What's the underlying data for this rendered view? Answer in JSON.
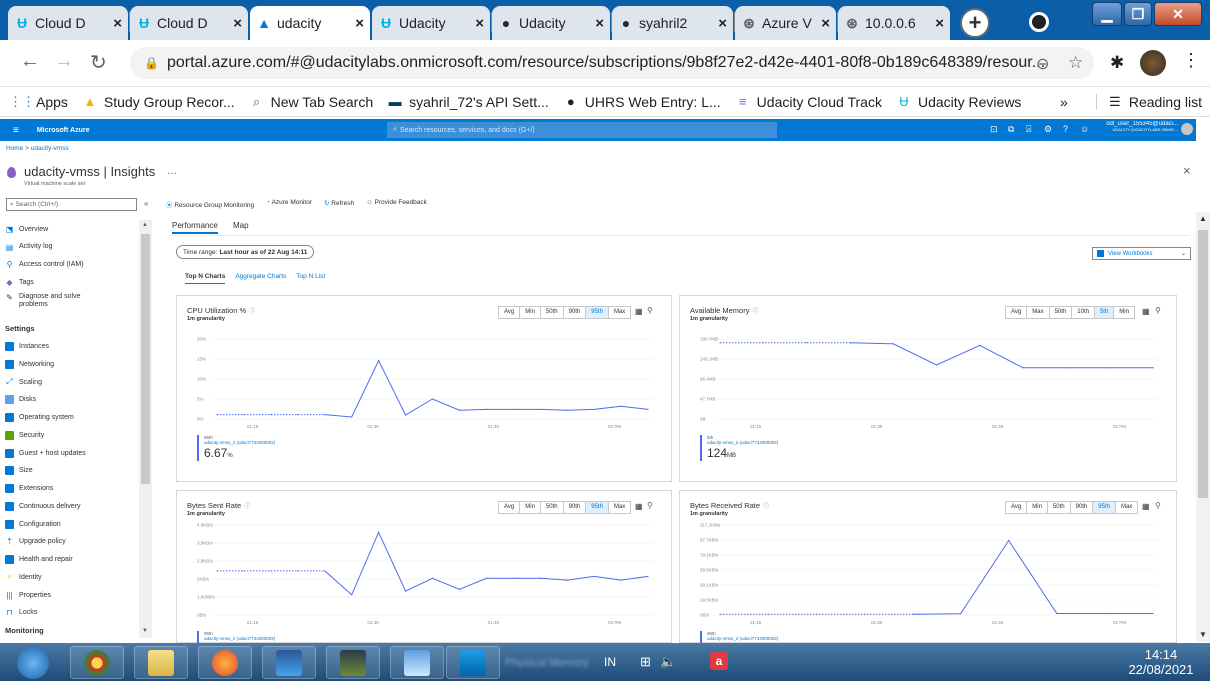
{
  "browser": {
    "tabs": [
      {
        "title": "Cloud D",
        "icon": "udacity-icon",
        "active": false
      },
      {
        "title": "Cloud D",
        "icon": "udacity-icon",
        "active": false
      },
      {
        "title": "udacity",
        "icon": "azure-icon",
        "active": true
      },
      {
        "title": "Udacity",
        "icon": "udacity-icon",
        "active": false
      },
      {
        "title": "Udacity",
        "icon": "github-icon",
        "active": false
      },
      {
        "title": "syahril2",
        "icon": "github-icon",
        "active": false
      },
      {
        "title": "Azure V",
        "icon": "globe-icon",
        "active": false
      },
      {
        "title": "10.0.0.6",
        "icon": "globe-icon",
        "active": false
      }
    ],
    "new_tab": "+",
    "url": "portal.azure.com/#@udacitylabs.onmicrosoft.com/resource/subscriptions/9b8f27e2-d42e-4401-80f8-0b189c648389/resour...",
    "bookmarks": [
      {
        "label": "Apps",
        "icon": "apps-grid-icon"
      },
      {
        "label": "Study Group Recor...",
        "icon": "drive-icon"
      },
      {
        "label": "New Tab Search",
        "icon": "search-icon"
      },
      {
        "label": "syahril_72's API Sett...",
        "icon": "api-icon"
      },
      {
        "label": "UHRS Web Entry: L...",
        "icon": "uhrs-icon"
      },
      {
        "label": "Udacity Cloud Track",
        "icon": "docs-icon"
      },
      {
        "label": "Udacity Reviews",
        "icon": "udacity-icon"
      }
    ],
    "bookmarks_overflow": "»",
    "reading_list": "Reading list"
  },
  "azure": {
    "brand": "Microsoft Azure",
    "search_placeholder": "Search resources, services, and docs (G+/)",
    "user_name": "odl_user_155345@udaci...",
    "user_tenant": "UDACITY (UDACITYLABS.ONMIC..."
  },
  "blade": {
    "breadcrumb_home": "Home",
    "breadcrumb_sep": ">",
    "breadcrumb_item": "udacity-vmss",
    "title": "udacity-vmss | Insights",
    "more": "···",
    "subtitle": "Virtual machine scale set",
    "close": "×",
    "search_placeholder": "Search (Ctrl+/)",
    "collapse": "«"
  },
  "sidebar": {
    "items_top": [
      {
        "label": "Overview",
        "icon": "overview-icon",
        "color": "#0078d4"
      },
      {
        "label": "Activity log",
        "icon": "activity-log-icon",
        "color": "#0078d4"
      },
      {
        "label": "Access control (IAM)",
        "icon": "iam-icon",
        "color": "#0078d4"
      },
      {
        "label": "Tags",
        "icon": "tag-icon",
        "color": "#8661c5"
      },
      {
        "label": "Diagnose and solve",
        "label2": "problems",
        "icon": "wrench-icon",
        "color": "#323130"
      }
    ],
    "settings_header": "Settings",
    "settings_items": [
      {
        "label": "Instances",
        "icon": "instances-icon",
        "color": "#0078d4"
      },
      {
        "label": "Networking",
        "icon": "networking-icon",
        "color": "#0078d4"
      },
      {
        "label": "Scaling",
        "icon": "scaling-icon",
        "color": "#0078d4"
      },
      {
        "label": "Disks",
        "icon": "disks-icon",
        "color": "#5ea0ef"
      },
      {
        "label": "Operating system",
        "icon": "os-icon",
        "color": "#0078d4"
      },
      {
        "label": "Security",
        "icon": "security-icon",
        "color": "#57a300"
      },
      {
        "label": "Guest + host updates",
        "icon": "updates-icon",
        "color": "#0078d4"
      },
      {
        "label": "Size",
        "icon": "size-icon",
        "color": "#0078d4"
      },
      {
        "label": "Extensions",
        "icon": "extensions-icon",
        "color": "#0078d4"
      },
      {
        "label": "Continuous delivery",
        "icon": "delivery-icon",
        "color": "#0078d4"
      },
      {
        "label": "Configuration",
        "icon": "configuration-icon",
        "color": "#0078d4"
      },
      {
        "label": "Upgrade policy",
        "icon": "upgrade-icon",
        "color": "#0078d4"
      },
      {
        "label": "Health and repair",
        "icon": "health-icon",
        "color": "#0078d4"
      },
      {
        "label": "Identity",
        "icon": "identity-icon",
        "color": "#ffb900"
      },
      {
        "label": "Properties",
        "icon": "properties-icon",
        "color": "#0078d4"
      },
      {
        "label": "Locks",
        "icon": "lock-icon",
        "color": "#0078d4"
      }
    ],
    "monitoring_header": "Monitoring"
  },
  "toolbar": {
    "resource_group_monitoring": "Resource Group Monitoring",
    "azure_monitor": "Azure Monitor",
    "refresh": "Refresh",
    "provide_feedback": "Provide Feedback"
  },
  "tabs": {
    "performance": "Performance",
    "map": "Map"
  },
  "time_range": {
    "label": "Time range:",
    "value": "Last hour as of 22 Aug 14:11"
  },
  "view_workbooks": "View Workbooks",
  "subtabs": {
    "top_n_charts": "Top N Charts",
    "aggregate_charts": "Aggregate Charts",
    "top_n_list": "Top N List"
  },
  "chart_data": [
    {
      "type": "line",
      "title": "CPU Utilization %",
      "granularity": "1m granularity",
      "aggregations": [
        "Avg",
        "Min",
        "50th",
        "90th",
        "95th",
        "Max"
      ],
      "selected": "95th",
      "yticks": [
        "20%",
        "15%",
        "10%",
        "5%",
        "0%"
      ],
      "ylim": [
        0,
        20
      ],
      "xticks": [
        "01:15",
        "01:30",
        "01:45",
        "02 PM"
      ],
      "x": [
        0,
        1,
        2,
        3,
        4,
        5,
        6,
        7,
        8,
        9,
        10,
        11,
        12,
        13,
        14,
        15,
        16
      ],
      "series": [
        {
          "values": [
            1.1,
            1.1,
            1.1,
            1.1,
            1.1,
            0.5,
            14.6,
            1.0,
            5.0,
            2.2,
            2.4,
            2.4,
            2.4,
            2.2,
            2.4,
            3.2,
            2.4
          ]
        }
      ],
      "dotted_until_index": 4,
      "legend_stat": "95th",
      "legend_series": "udacity-vmss_2 (udaci7734000002)",
      "legend_value": "6.67",
      "legend_unit": "%"
    },
    {
      "type": "line",
      "title": "Available Memory",
      "granularity": "1m granularity",
      "aggregations": [
        "Avg",
        "Max",
        "50th",
        "10th",
        "5th",
        "Min"
      ],
      "selected": "5th",
      "yticks": [
        "190.7MB",
        "143.1MB",
        "95.4MB",
        "47.7MB",
        "0B"
      ],
      "ylim": [
        0,
        200
      ],
      "xticks": [
        "01:15",
        "01:30",
        "01:45",
        "02 PM"
      ],
      "x": [
        0,
        1,
        2,
        3,
        4,
        5,
        6,
        7,
        8,
        9,
        10
      ],
      "series": [
        {
          "values": [
            190.7,
            190.7,
            190.7,
            190.7,
            188,
            135,
            184,
            128,
            128,
            128,
            128
          ]
        }
      ],
      "dotted_until_index": 3,
      "legend_stat": "5th",
      "legend_series": "udacity-vmss_2 (udaci7734000002)",
      "legend_value": "124",
      "legend_unit": "MB"
    },
    {
      "type": "line",
      "title": "Bytes Sent Rate",
      "granularity": "1m granularity",
      "aggregations": [
        "Avg",
        "Min",
        "50th",
        "90th",
        "95th",
        "Max"
      ],
      "selected": "95th",
      "yticks": [
        "4.9KB/s",
        "3.9KB/s",
        "2.9KB/s",
        "2KB/s",
        "1,000B/s",
        "0B/s"
      ],
      "ylim": [
        0,
        4.9
      ],
      "xticks": [
        "01:15",
        "01:30",
        "01:45",
        "02 PM"
      ],
      "x": [
        0,
        1,
        2,
        3,
        4,
        5,
        6,
        7,
        8,
        9,
        10,
        11,
        12,
        13,
        14,
        15,
        16
      ],
      "series": [
        {
          "values": [
            2.4,
            2.4,
            2.4,
            2.4,
            2.4,
            1.1,
            4.5,
            1.3,
            2.0,
            1.4,
            2.0,
            2.0,
            2.0,
            1.9,
            2.1,
            1.9,
            2.1
          ]
        }
      ],
      "dotted_until_index": 4,
      "legend_stat": "95th",
      "legend_series": "udacity-vmss_2 (udaci7734000002)"
    },
    {
      "type": "line",
      "title": "Bytes Received Rate",
      "granularity": "1m granularity",
      "aggregations": [
        "Avg",
        "Min",
        "50th",
        "90th",
        "95th",
        "Max"
      ],
      "selected": "95th",
      "yticks": [
        "117.2KB/s",
        "97.7KB/s",
        "78.1KB/s",
        "58.6KB/s",
        "39.1KB/s",
        "19.5KB/s",
        "0B/s"
      ],
      "ylim": [
        0,
        117.2
      ],
      "xticks": [
        "01:15",
        "01:30",
        "01:45",
        "02 PM"
      ],
      "x": [
        0,
        1,
        2,
        3,
        4,
        5,
        6,
        7,
        8,
        9
      ],
      "series": [
        {
          "values": [
            1.0,
            1.0,
            1.0,
            1.0,
            1.0,
            1.5,
            97.0,
            2.0,
            2.0,
            2.0
          ]
        }
      ],
      "dotted_until_index": 4,
      "legend_stat": "95th",
      "legend_series": "udacity-vmss_2 (udaci7734000002)"
    }
  ],
  "taskbar": {
    "items": [
      "start-orb-icon",
      "chrome-icon",
      "file-explorer-icon",
      "firefox-icon",
      "word-icon",
      "terminal-icon",
      "control-panel-icon",
      "vscode-icon"
    ],
    "task_label": "Physical Memory",
    "lang": "IN",
    "time": "14:14",
    "date": "22/08/2021"
  }
}
